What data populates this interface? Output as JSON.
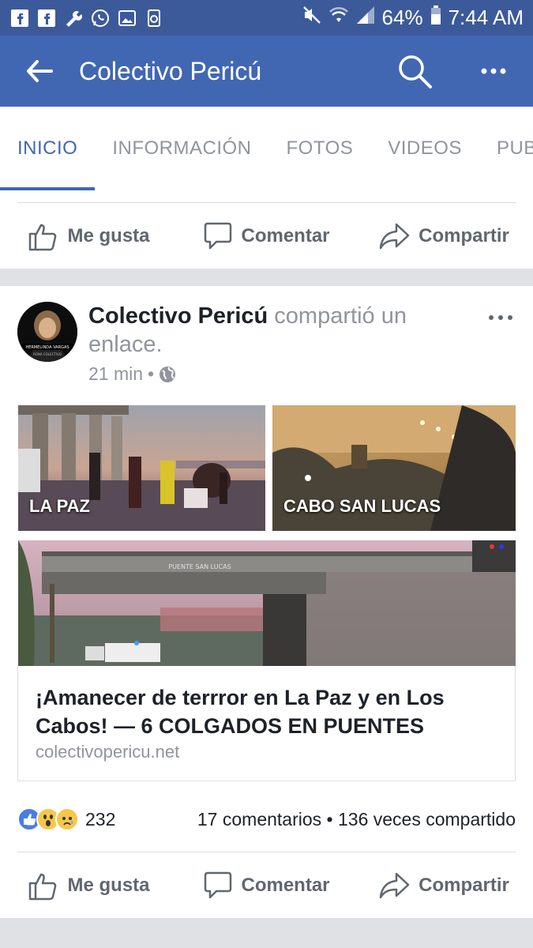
{
  "status_bar": {
    "left_icons": [
      "facebook-icon",
      "facebook-icon",
      "wrench-icon",
      "whatsapp-icon",
      "gallery-icon",
      "recycle-icon"
    ],
    "battery": "64%",
    "time": "7:44 AM"
  },
  "app_bar": {
    "title": "Colectivo Pericú",
    "back_icon": "back-arrow-icon",
    "search_icon": "search-icon",
    "more_icon": "more-icon"
  },
  "tabs": [
    {
      "label": "INICIO",
      "active": true
    },
    {
      "label": "INFORMACIÓN",
      "active": false
    },
    {
      "label": "FOTOS",
      "active": false
    },
    {
      "label": "VIDEOS",
      "active": false
    },
    {
      "label": "PUBL",
      "active": false
    }
  ],
  "action_bar": {
    "like": "Me gusta",
    "comment": "Comentar",
    "share": "Compartir"
  },
  "post": {
    "author": "Colectivo Pericú",
    "action_text": " compartió un enlace.",
    "time": "21 min",
    "privacy_icon": "globe-icon",
    "avatar_text": "HERMELINDA VARGAS",
    "avatar_subtext": "RONA COLECTIVO",
    "images": [
      {
        "caption": "LA PAZ"
      },
      {
        "caption": "CABO SAN LUCAS"
      },
      {
        "caption": ""
      }
    ],
    "bridge_sign": "PUENTE SAN LUCAS",
    "link": {
      "headline": "¡Amanecer de terrror en La Paz y en Los Cabos! — 6 COLGADOS EN PUENTES",
      "domain": "colectivopericu.net"
    },
    "reactions_count": "232",
    "comments": "17 comentarios",
    "separator": "•",
    "shares": "136 veces compartido"
  },
  "colors": {
    "brand_blue": "#4267b2",
    "gray_text": "#606770",
    "light_gray": "#90949c"
  }
}
